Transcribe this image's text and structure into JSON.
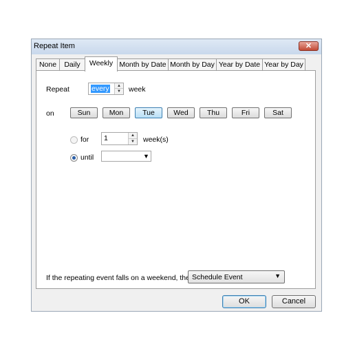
{
  "window": {
    "title": "Repeat Item",
    "close_glyph": "✕"
  },
  "tabs": [
    {
      "label": "None"
    },
    {
      "label": "Daily"
    },
    {
      "label": "Weekly"
    },
    {
      "label": "Month by Date"
    },
    {
      "label": "Month by Day"
    },
    {
      "label": "Year by Date"
    },
    {
      "label": "Year by Day"
    }
  ],
  "active_tab": "Weekly",
  "repeat": {
    "label": "Repeat",
    "value": "every",
    "suffix": "week"
  },
  "days": {
    "label": "on",
    "items": [
      "Sun",
      "Mon",
      "Tue",
      "Wed",
      "Thu",
      "Fri",
      "Sat"
    ],
    "selected": "Tue"
  },
  "duration": {
    "for_label": "for",
    "for_value": "1",
    "for_unit": "week(s)",
    "until_label": "until",
    "until_value": "",
    "selected": "until"
  },
  "weekend": {
    "label": "If the repeating event falls on a weekend, then:",
    "value": "Schedule Event"
  },
  "buttons": {
    "ok": "OK",
    "cancel": "Cancel"
  },
  "icons": {
    "spin_up": "▲",
    "spin_down": "▼",
    "dropdown": "▼"
  },
  "colors": {
    "selection": "#3399ff",
    "active_day": "#b9dff6",
    "close": "#c24a36"
  }
}
